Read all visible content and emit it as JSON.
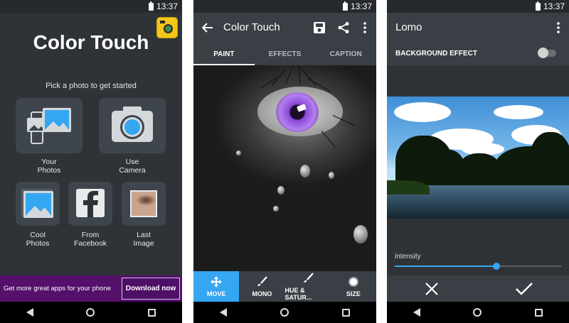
{
  "status": {
    "time": "13:37"
  },
  "home": {
    "title": "Color Touch",
    "subtitle": "Pick a photo to get started",
    "tiles": [
      {
        "label_line1": "Your",
        "label_line2": "Photos",
        "icon": "photos-icon"
      },
      {
        "label_line1": "Use",
        "label_line2": "Camera",
        "icon": "camera-icon"
      },
      {
        "label_line1": "Cool",
        "label_line2": "Photos",
        "icon": "picture-icon"
      },
      {
        "label_line1": "From",
        "label_line2": "Facebook",
        "icon": "facebook-icon"
      },
      {
        "label_line1": "Last",
        "label_line2": "Image",
        "icon": "last-image-thumbnail"
      }
    ],
    "promo": {
      "text": "Get more great apps for your phone",
      "button": "Download now"
    },
    "colors": {
      "accent": "#35a6f2",
      "promo_bg": "#54106b",
      "background": "#2f3338"
    }
  },
  "editor": {
    "title": "Color Touch",
    "tabs": [
      {
        "label": "PAINT",
        "active": true
      },
      {
        "label": "EFFECTS",
        "active": false
      },
      {
        "label": "CAPTION",
        "active": false
      }
    ],
    "tools": [
      {
        "label": "MOVE",
        "icon": "move-icon",
        "active": true
      },
      {
        "label": "MONO",
        "icon": "brush-icon",
        "active": false
      },
      {
        "label": "HUE & SATUR...",
        "icon": "brush-icon",
        "active": false
      },
      {
        "label": "SIZE",
        "icon": "size-icon",
        "active": false
      }
    ]
  },
  "effect": {
    "title": "Lomo",
    "background_effect_label": "BACKGROUND EFFECT",
    "background_effect_on": false,
    "intensity_label": "intensity",
    "intensity_value": 0.61
  }
}
